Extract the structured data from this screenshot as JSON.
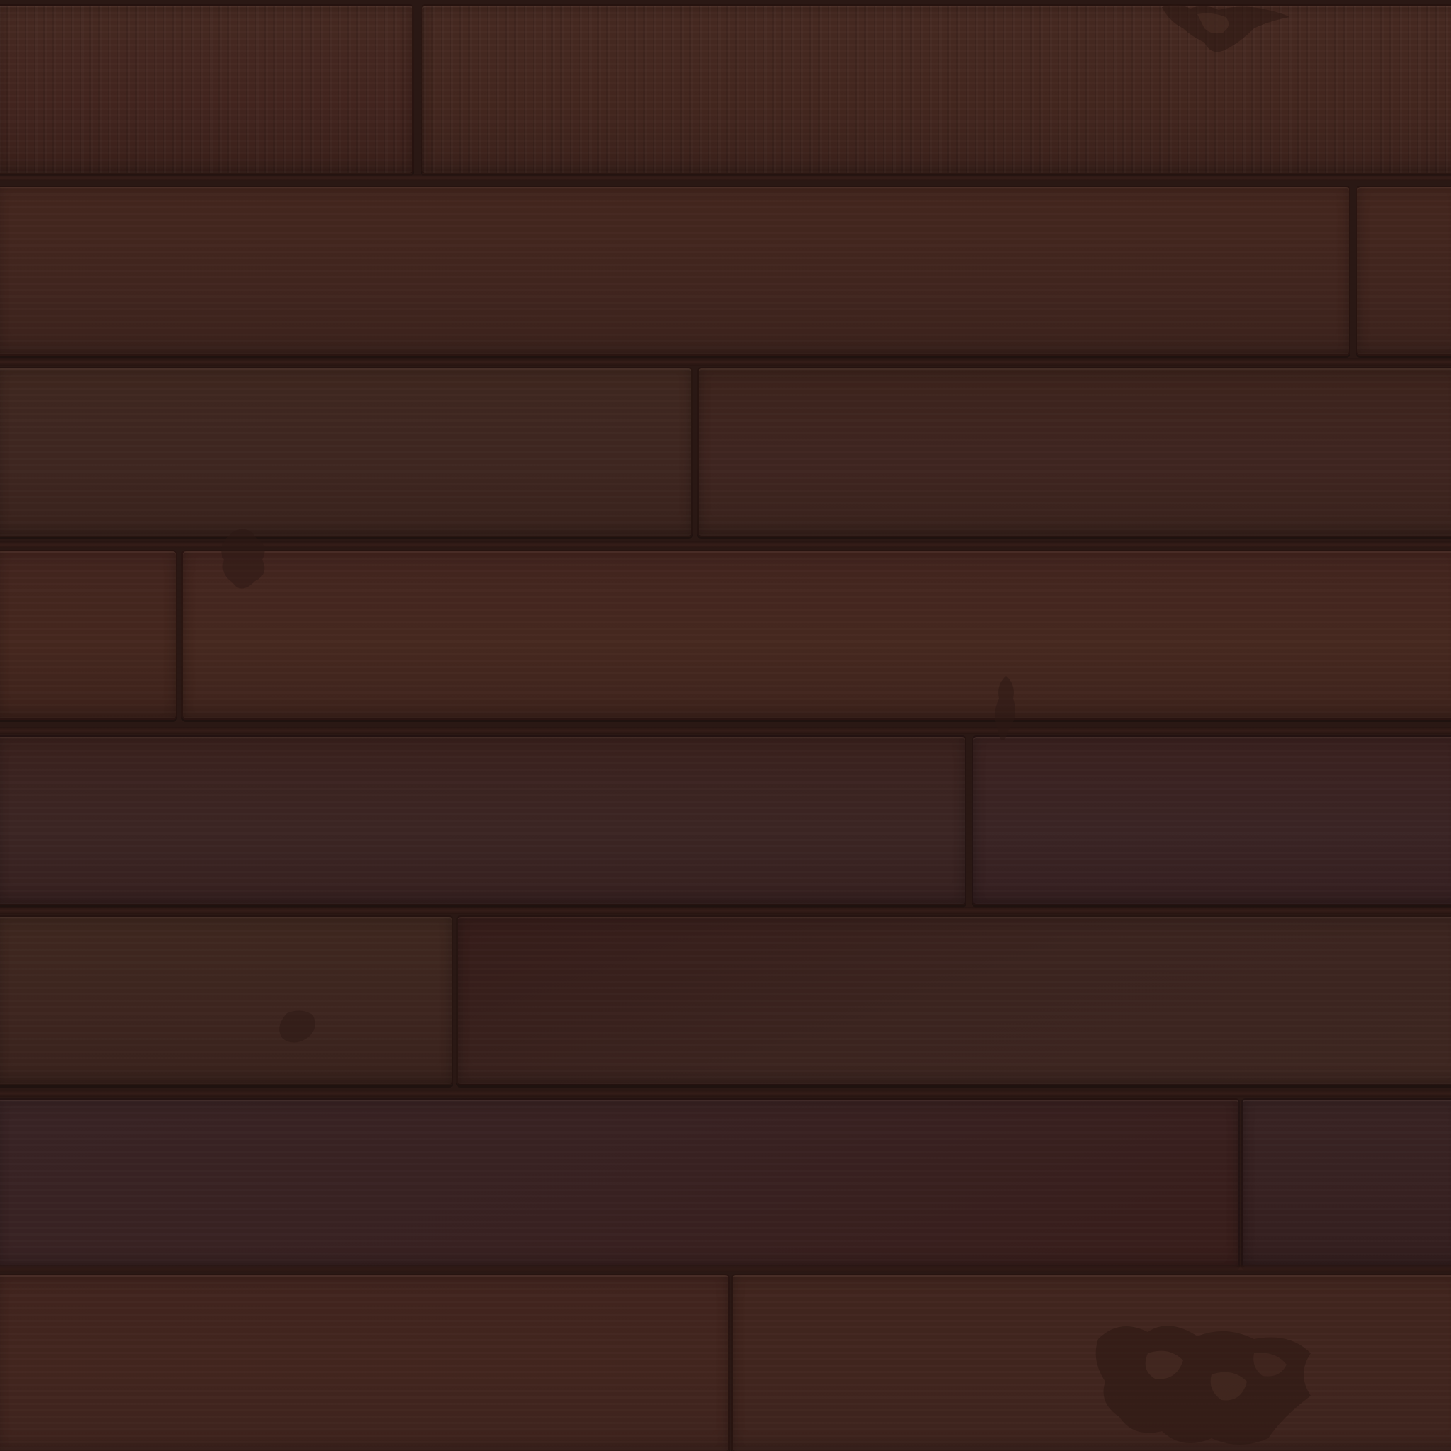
{
  "scene": {
    "type": "wood plank floor texture",
    "colors": {
      "plank_warm": "#45271f",
      "plank_mid": "#3e2620",
      "plank_cool": "#3a2424",
      "seam": "#2a1814",
      "stain": "#2c1713"
    },
    "rows": [
      {
        "tone": "warm",
        "planks": 2,
        "streaks": true
      },
      {
        "tone": "warm",
        "planks": 2
      },
      {
        "tone": "mid",
        "planks": 2
      },
      {
        "tone": "warm",
        "planks": 2
      },
      {
        "tone": "cool",
        "planks": 2
      },
      {
        "tone": "mid",
        "planks": 2
      },
      {
        "tone": "cool",
        "planks": 2
      },
      {
        "tone": "warm",
        "planks": 2
      }
    ],
    "stains": [
      {
        "type": "chipped-paint-icon"
      },
      {
        "type": "stain-icon"
      },
      {
        "type": "stain-icon"
      },
      {
        "type": "stain-icon"
      },
      {
        "type": "chipped-paint-icon"
      }
    ]
  }
}
